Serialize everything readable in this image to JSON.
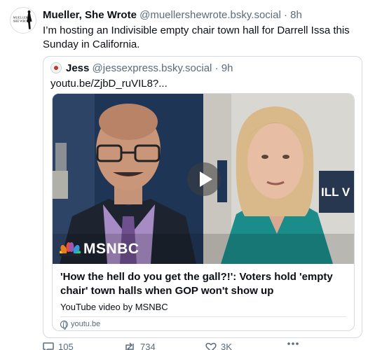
{
  "post": {
    "author": {
      "display_name": "Mueller, She Wrote",
      "handle": "@muellershewrote.bsky.social",
      "time": "8h",
      "avatar_lines": [
        "MUELLER,",
        "SHE WROTE"
      ]
    },
    "separator": "·",
    "text": "I’m hosting an Indivisible empty chair town hall for Darrell Issa this Sunday in California."
  },
  "quote": {
    "author": {
      "display_name": "Jess",
      "handle": "@jessexpress.bsky.social",
      "time": "9h"
    },
    "separator": "·",
    "link_text": "youtu.be/ZjbD_ruVIL8?...",
    "embed": {
      "thumbnail_logo": "MSNBC",
      "background_sign": "ILL V",
      "title": "'How the hell do you get the gall?!': Voters hold 'empty chair' town halls when GOP won't show up",
      "description": "YouTube video by MSNBC",
      "domain": "youtu.be"
    }
  },
  "actions": {
    "reply_count": "105",
    "repost_count": "734",
    "like_count": "3K"
  },
  "colors": {
    "text": "#0b0f14",
    "muted": "#5b6b7c",
    "border": "#d4dbe2",
    "green_shirt": "#1a8c8a"
  },
  "icons": [
    "reply-icon",
    "repost-icon",
    "heart-icon",
    "more-icon",
    "play-icon",
    "globe-icon",
    "msnbc-peacock-icon"
  ]
}
